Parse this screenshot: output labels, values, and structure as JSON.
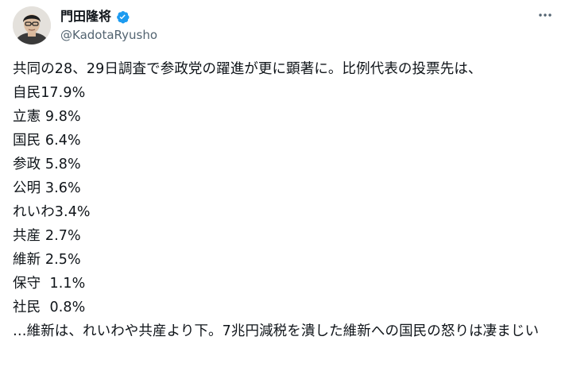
{
  "author": {
    "display_name": "門田隆将",
    "handle": "@KadotaRyusho",
    "verified": true,
    "avatar_icon": "avatar-photo",
    "verified_icon": "verified-badge-icon",
    "verified_color": "#1d9bf0"
  },
  "menu": {
    "icon": "more-horizontal-icon"
  },
  "tweet": {
    "intro": "共同の28、29日調査で参政党の躍進が更に顕著に。比例代表の投票先は、",
    "results": [
      "自民17.9%",
      "立憲 9.8%",
      "国民 6.4%",
      "参政 5.8%",
      "公明 3.6%",
      "れいわ3.4%",
      "共産 2.7%",
      "維新 2.5%",
      "保守  1.1%",
      "社民  0.8%"
    ],
    "outro": "…維新は、れいわや共産より下。7兆円減税を潰した維新への国民の怒りは凄まじい"
  }
}
